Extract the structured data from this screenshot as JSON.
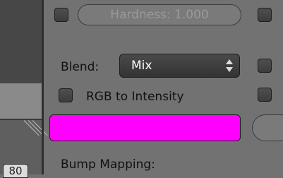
{
  "sidebar": {
    "ruler_number": "80"
  },
  "texture": {
    "hardness_field": "Hardness: 1.000",
    "blend_label": "Blend:",
    "blend_value": "Mix",
    "rgb_to_intensity_label": "RGB to Intensity",
    "color_swatch": "#ff00ff",
    "bump_mapping_label": "Bump Mapping:"
  }
}
